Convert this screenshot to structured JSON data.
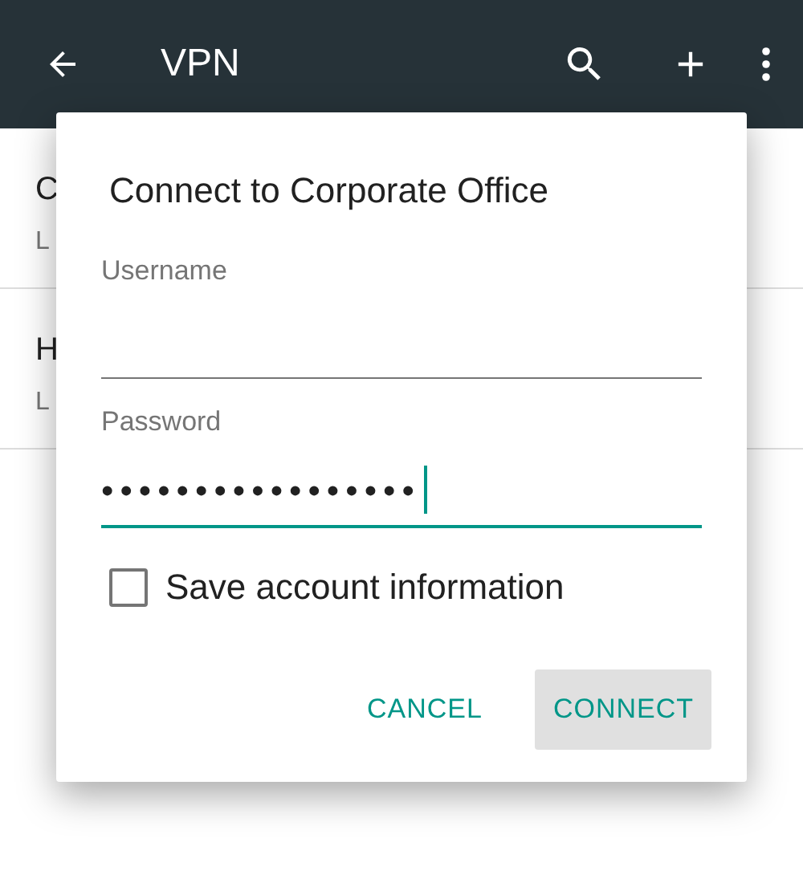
{
  "toolbar": {
    "title": "VPN"
  },
  "list": [
    {
      "title": "C",
      "subtitle": "L"
    },
    {
      "title": "H",
      "subtitle": "L"
    }
  ],
  "dialog": {
    "title": "Connect to Corporate Office",
    "fields": [
      {
        "label": "Username",
        "focused": false
      },
      {
        "label": "Password",
        "value": "•••••••••••••••••",
        "focused": true
      }
    ],
    "checkbox": {
      "label": "Save account information",
      "checked": false
    },
    "buttons": [
      {
        "label": "CANCEL",
        "selected": false
      },
      {
        "label": "CONNECT",
        "selected": true
      }
    ]
  }
}
